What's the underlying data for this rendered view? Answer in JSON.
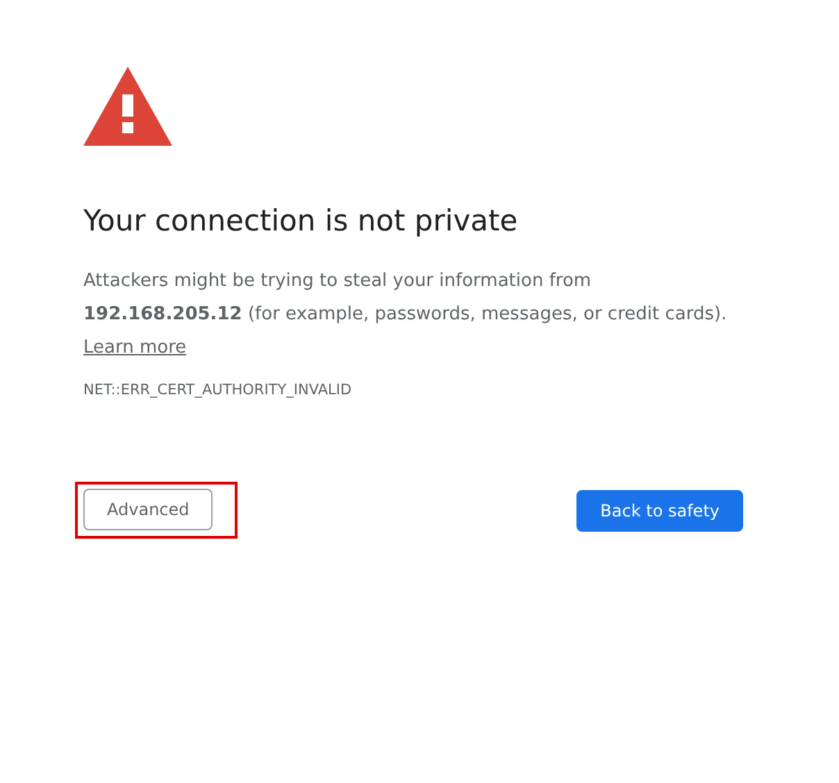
{
  "heading": "Your connection is not private",
  "message": {
    "host": "192.168.205.12",
    "before": "Attackers might be trying to steal your information from",
    "after": "(for example, passwords, messages, or credit cards)."
  },
  "learn_more": "Learn more",
  "error_code": "NET::ERR_CERT_AUTHORITY_INVALID",
  "buttons": [
    {
      "kind": "secondary",
      "label": "Advanced",
      "highlighted": true
    },
    {
      "kind": "primary",
      "label": "Back to safety",
      "highlighted": false
    }
  ]
}
